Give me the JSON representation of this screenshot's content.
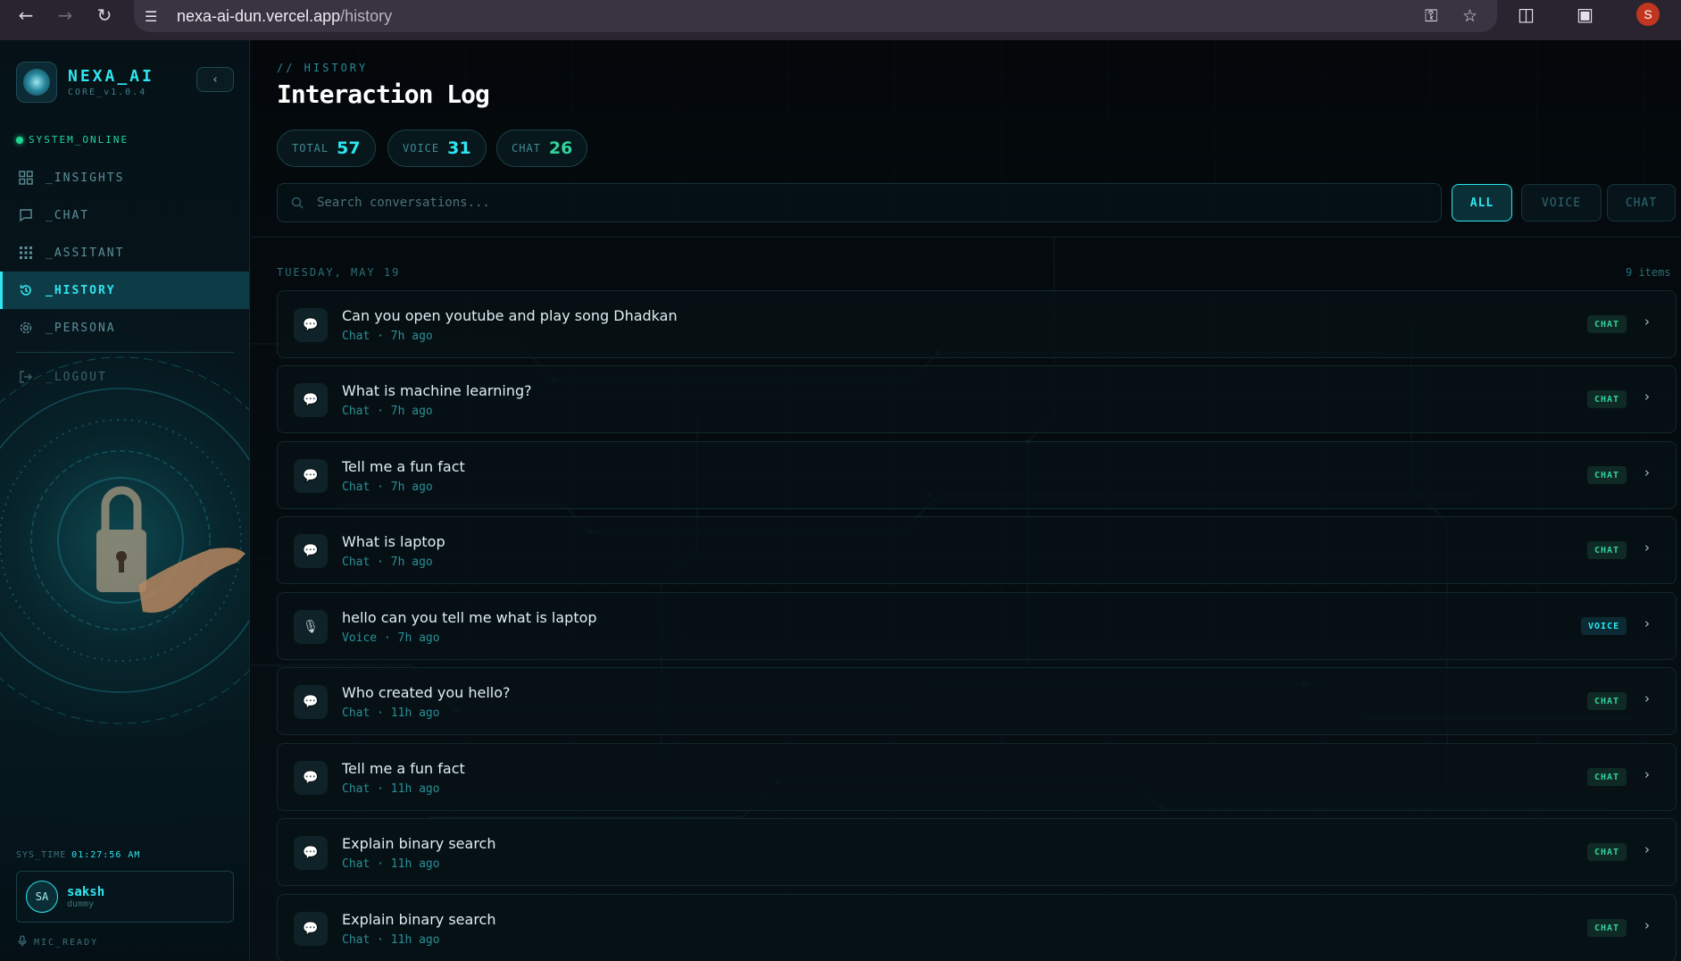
{
  "browser": {
    "url_host": "nexa-ai-dun.vercel.app",
    "url_path": "/history",
    "profile_initial": "S"
  },
  "sidebar": {
    "brand_name": "NEXA_AI",
    "brand_version": "CORE_v1.0.4",
    "collapse_label": "‹",
    "status": "SYSTEM_ONLINE",
    "items": [
      {
        "label": "_INSIGHTS",
        "icon": "grid-icon"
      },
      {
        "label": "_CHAT",
        "icon": "chat-icon"
      },
      {
        "label": "_ASSITANT",
        "icon": "dots-grid-icon"
      },
      {
        "label": "_HISTORY",
        "icon": "history-icon"
      },
      {
        "label": "_PERSONA",
        "icon": "gear-icon"
      }
    ],
    "logout_label": "_LOGOUT",
    "systime_label": "SYS_TIME",
    "systime_value": "01:27:56 AM",
    "user": {
      "initials": "SA",
      "name": "saksh",
      "role": "dummy"
    },
    "mic_status": "MIC_READY"
  },
  "main": {
    "breadcrumb": "// HISTORY",
    "title": "Interaction Log",
    "stats": [
      {
        "label": "TOTAL",
        "value": "57",
        "color": "#2ee6f0"
      },
      {
        "label": "VOICE",
        "value": "31",
        "color": "#2ee6f0"
      },
      {
        "label": "CHAT",
        "value": "26",
        "color": "#33d29a"
      }
    ],
    "search_placeholder": "Search conversations...",
    "filters": [
      {
        "label": "ALL",
        "active": true
      },
      {
        "label": "VOICE",
        "active": false
      },
      {
        "label": "CHAT",
        "active": false
      }
    ],
    "date_header": "TUESDAY, MAY 19",
    "count_header": "9 items",
    "rows": [
      {
        "title": "Can you open youtube and play song Dhadkan",
        "meta": "Chat · 7h ago",
        "badge": "CHAT",
        "type": "chat"
      },
      {
        "title": "What is machine learning?",
        "meta": "Chat · 7h ago",
        "badge": "CHAT",
        "type": "chat"
      },
      {
        "title": "Tell me a fun fact",
        "meta": "Chat · 7h ago",
        "badge": "CHAT",
        "type": "chat"
      },
      {
        "title": "What is laptop",
        "meta": "Chat · 7h ago",
        "badge": "CHAT",
        "type": "chat"
      },
      {
        "title": "hello can you tell me what is laptop",
        "meta": "Voice · 7h ago",
        "badge": "VOICE",
        "type": "voice"
      },
      {
        "title": "Who created you hello?",
        "meta": "Chat · 11h ago",
        "badge": "CHAT",
        "type": "chat"
      },
      {
        "title": "Tell me a fun fact",
        "meta": "Chat · 11h ago",
        "badge": "CHAT",
        "type": "chat"
      },
      {
        "title": "Explain binary search",
        "meta": "Chat · 11h ago",
        "badge": "CHAT",
        "type": "chat"
      },
      {
        "title": "Explain binary search",
        "meta": "Chat · 11h ago",
        "badge": "CHAT",
        "type": "chat"
      }
    ]
  },
  "colors": {
    "accent": "#2ee6f0",
    "chat_green": "#33d29a",
    "status_green": "#1ed68f",
    "background": "#05090d"
  }
}
